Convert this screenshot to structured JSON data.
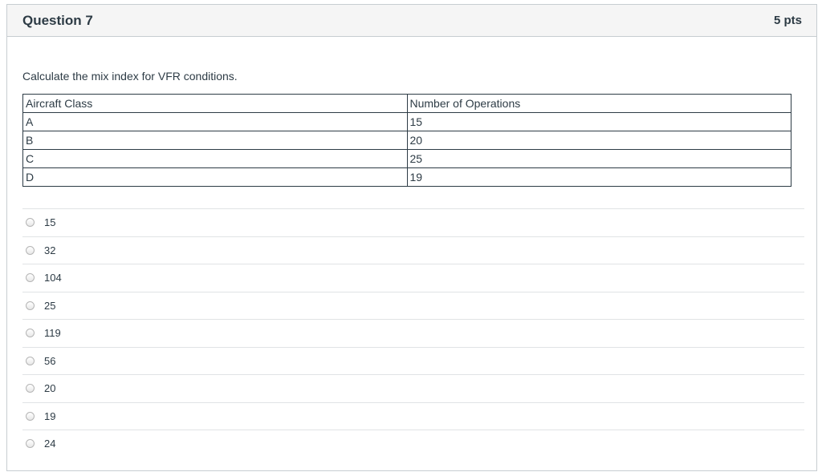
{
  "question": {
    "title": "Question 7",
    "points": "5 pts",
    "text": "Calculate the mix index for VFR conditions."
  },
  "table": {
    "headers": [
      "Aircraft Class",
      "Number of Operations"
    ],
    "rows": [
      [
        "A",
        "15"
      ],
      [
        "B",
        "20"
      ],
      [
        "C",
        "25"
      ],
      [
        "D",
        "19"
      ]
    ]
  },
  "answers": [
    "15",
    "32",
    "104",
    "25",
    "119",
    "56",
    "20",
    "19",
    "24"
  ]
}
